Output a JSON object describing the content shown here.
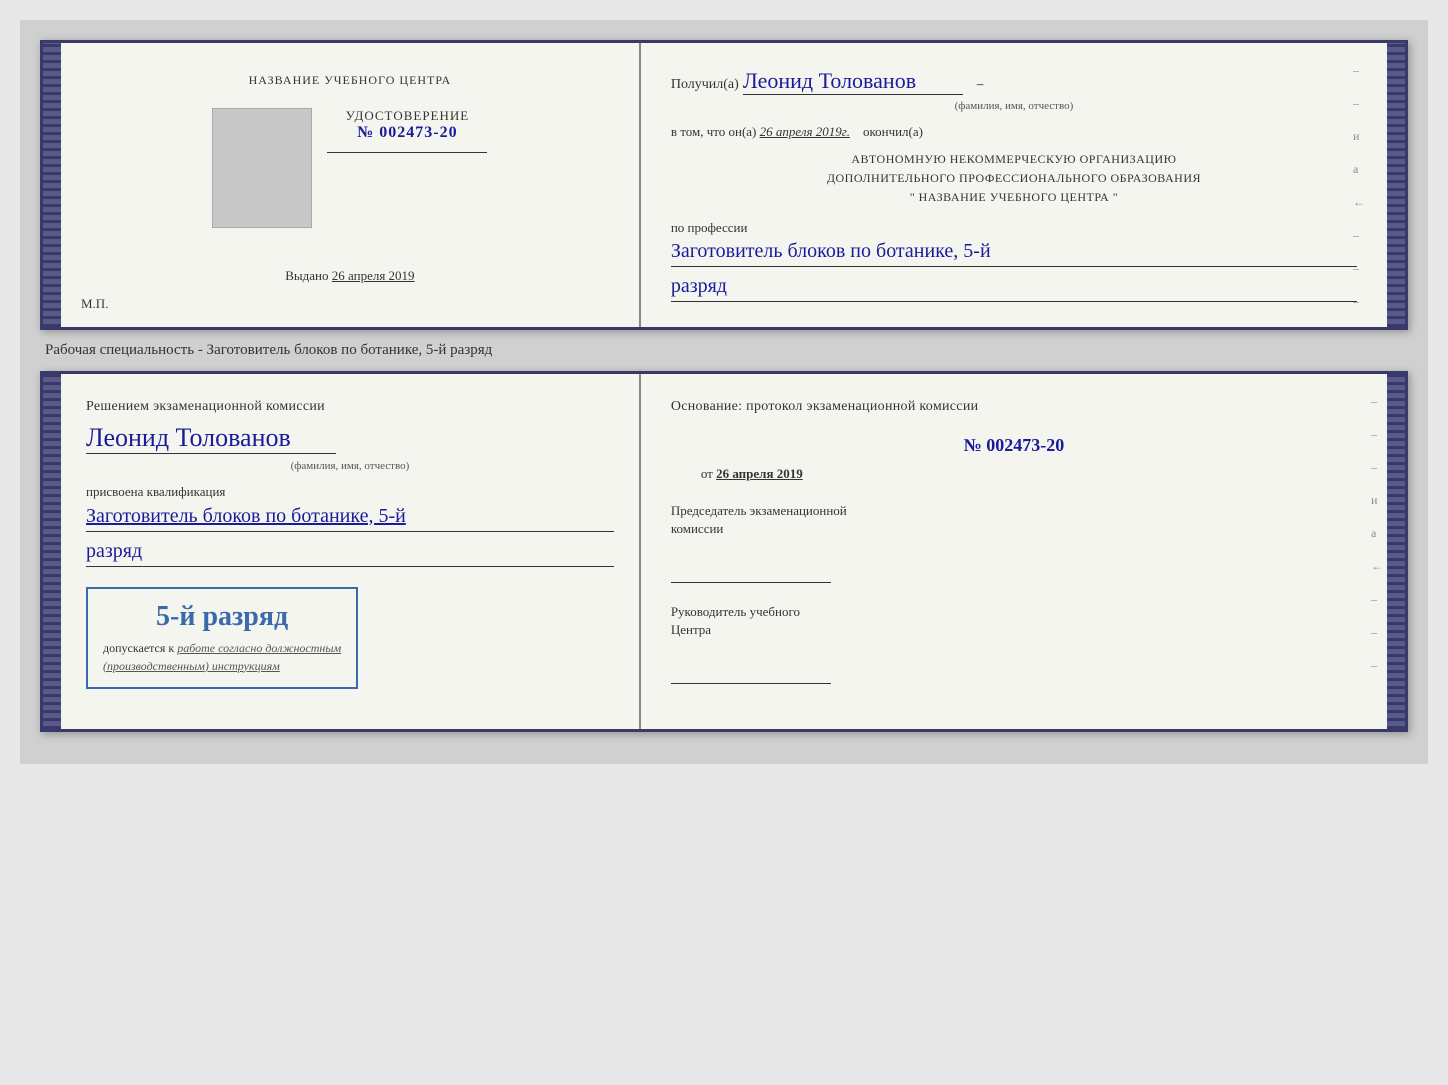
{
  "page": {
    "background": "#d4d4d4"
  },
  "top_cert": {
    "left": {
      "institution_label": "НАЗВАНИЕ УЧЕБНОГО ЦЕНТРА",
      "udostoverenie_title": "УДОСТОВЕРЕНИЕ",
      "number": "№ 002473-20",
      "vydano_label": "Выдано",
      "vydano_date": "26 апреля 2019",
      "mp_label": "М.П."
    },
    "right": {
      "poluchil_prefix": "Получил(а)",
      "poluchil_name": "Леонид Толованов",
      "fio_label": "(фамилия, имя, отчество)",
      "vtom_prefix": "в том, что он(а)",
      "vtom_date": "26 апреля 2019г.",
      "okonchil": "окончил(а)",
      "org_line1": "АВТОНОМНУЮ НЕКОММЕРЧЕСКУЮ ОРГАНИЗАЦИЮ",
      "org_line2": "ДОПОЛНИТЕЛЬНОГО ПРОФЕССИОНАЛЬНОГО ОБРАЗОВАНИЯ",
      "org_line3": "\"   НАЗВАНИЕ УЧЕБНОГО ЦЕНТРА   \"",
      "po_professii": "по профессии",
      "professiya": "Заготовитель блоков по ботанике, 5-й",
      "razryad": "разряд"
    }
  },
  "specialty_label": "Рабочая специальность - Заготовитель блоков по ботанике, 5-й разряд",
  "bottom_cert": {
    "left": {
      "resheniem": "Решением экзаменационной комиссии",
      "person_name": "Леонид Толованов",
      "fio_label": "(фамилия, имя, отчество)",
      "prisvoena": "присвоена квалификация",
      "kvalifikaciya": "Заготовитель блоков по ботанике, 5-й",
      "razryad": "разряд",
      "stamp_razryad": "5-й разряд",
      "dopuskaetsya": "допускается к",
      "dopuskaetsya_rest": "работе согласно должностным",
      "instrukciyi": "(производственным) инструкциям"
    },
    "right": {
      "osnovanie": "Основание: протокол экзаменационной комиссии",
      "number": "№  002473-20",
      "ot_label": "от",
      "ot_date": "26 апреля 2019",
      "predsedatel_title": "Председатель экзаменационной",
      "predsedatel_title2": "комиссии",
      "rukovoditel_title": "Руководитель учебного",
      "rukovoditel_title2": "Центра"
    }
  }
}
